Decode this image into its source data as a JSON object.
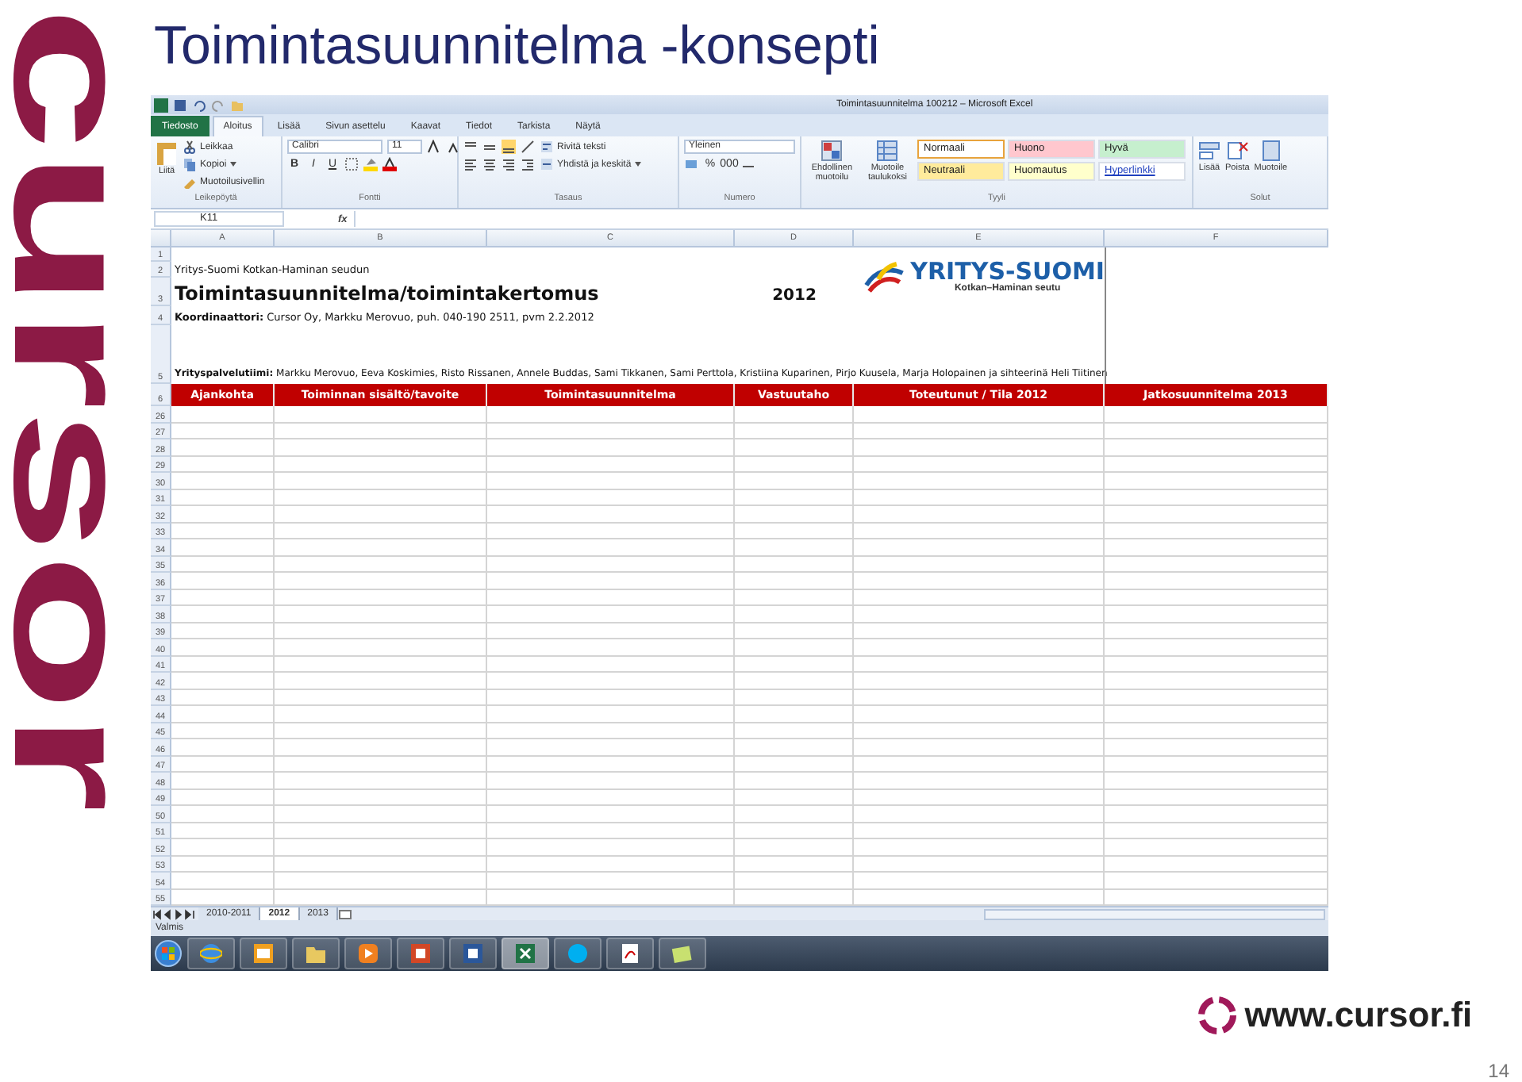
{
  "slide": {
    "logo_text": "cursor",
    "title": "Toimintasuunnitelma -konsepti",
    "footer_url": "www.cursor.fi",
    "page_number": "14"
  },
  "excel": {
    "window_title": "Toimintasuunnitelma 100212  –  Microsoft Excel",
    "ribbon_tabs": [
      {
        "label": "Tiedosto",
        "kind": "file",
        "selected": false
      },
      {
        "label": "Aloitus",
        "kind": "tab",
        "selected": true
      },
      {
        "label": "Lisää",
        "kind": "tab",
        "selected": false
      },
      {
        "label": "Sivun asettelu",
        "kind": "tab",
        "selected": false
      },
      {
        "label": "Kaavat",
        "kind": "tab",
        "selected": false
      },
      {
        "label": "Tiedot",
        "kind": "tab",
        "selected": false
      },
      {
        "label": "Tarkista",
        "kind": "tab",
        "selected": false
      },
      {
        "label": "Näytä",
        "kind": "tab",
        "selected": false
      }
    ],
    "clipboard": {
      "label": "Leikepöytä",
      "paste": "Liitä",
      "cut": "Leikkaa",
      "copy": "Kopioi",
      "painter": "Muotoilusivellin"
    },
    "font": {
      "label": "Fontti",
      "font_name": "Calibri",
      "font_size": "11",
      "bold": "B",
      "italic": "I",
      "underline": "U"
    },
    "alignment": {
      "label": "Tasaus",
      "wrap": "Rivitä teksti",
      "merge": "Yhdistä ja keskitä"
    },
    "number": {
      "label": "Numero",
      "format": "Yleinen",
      "percent": "%",
      "thousands": "000"
    },
    "styles": {
      "label": "Tyyli",
      "conditional": "Ehdollinen muotoilu",
      "as_table": "Muotoile taulukoksi",
      "cell_styles": [
        {
          "label": "Normaali",
          "color": "#ffffff",
          "kind": "plain",
          "selected": true
        },
        {
          "label": "Huono",
          "color": "#ffc7ce",
          "kind": "plain",
          "selected": false
        },
        {
          "label": "Hyvä",
          "color": "#c6efce",
          "kind": "plain",
          "selected": false
        },
        {
          "label": "Neutraali",
          "color": "#ffeb9c",
          "kind": "plain",
          "selected": false
        },
        {
          "label": "Huomautus",
          "color": "#ffffcc",
          "kind": "plain",
          "selected": false
        },
        {
          "label": "Hyperlinkki",
          "color": "#ffffff",
          "kind": "link",
          "selected": false
        }
      ]
    },
    "cells": {
      "label": "Solut",
      "insert": "Lisää",
      "delete": "Poista",
      "format": "Muotoile"
    },
    "formula_bar": {
      "name_box": "K11",
      "fx": "fx"
    },
    "columns": [
      "A",
      "B",
      "C",
      "D",
      "E",
      "F"
    ],
    "top_rows": [
      {
        "number": "1"
      },
      {
        "number": "2",
        "text": "Yritys-Suomi Kotkan-Haminan seudun"
      },
      {
        "number": "3",
        "text": "Toimintasuunnitelma/toimintakertomus",
        "year": "2012"
      },
      {
        "number": "4",
        "text": "**Koordinaattori:**  Cursor Oy, Markku Merovuo, puh. 040-190 2511, pvm 2.2.2012"
      },
      {
        "number": "5",
        "text": "**Yrityspalvelutiimi:** Markku Merovuo, Eeva Koskimies, Risto Rissanen, Annele Buddas, Sami Tikkanen, Sami Perttola, Kristiina Kuparinen, Pirjo Kuusela, Marja Holopainen ja sihteerinä Heli Tiitinen"
      }
    ],
    "sheet_logo": {
      "name": "YRITYS-SUOMI",
      "region": "Kotkan–Haminan seutu"
    },
    "header_row": {
      "number": "6",
      "cells": [
        "Ajankohta",
        "Toiminnan sisältö/tavoite",
        "Toimintasuunnitelma",
        "Vastuutaho",
        "Toteutunut / Tila 2012",
        "Jatkosuunnitelma 2013"
      ]
    },
    "empty_rows": [
      "26",
      "27",
      "28",
      "29",
      "30",
      "31",
      "32",
      "33",
      "34",
      "35",
      "36",
      "37",
      "38",
      "39",
      "40",
      "41",
      "42",
      "43",
      "44",
      "45",
      "46",
      "47",
      "48",
      "49",
      "50",
      "51",
      "52",
      "53",
      "54",
      "55"
    ],
    "sheet_tabs": [
      {
        "label": "2010-2011",
        "selected": false
      },
      {
        "label": "2012",
        "selected": true
      },
      {
        "label": "2013",
        "selected": false
      }
    ],
    "status": "Valmis",
    "taskbar": [
      {
        "selected": false
      },
      {
        "selected": false
      },
      {
        "selected": false
      },
      {
        "selected": false
      },
      {
        "selected": false
      },
      {
        "selected": false
      },
      {
        "selected": true
      },
      {
        "selected": false
      },
      {
        "selected": false
      },
      {
        "selected": false
      }
    ]
  }
}
